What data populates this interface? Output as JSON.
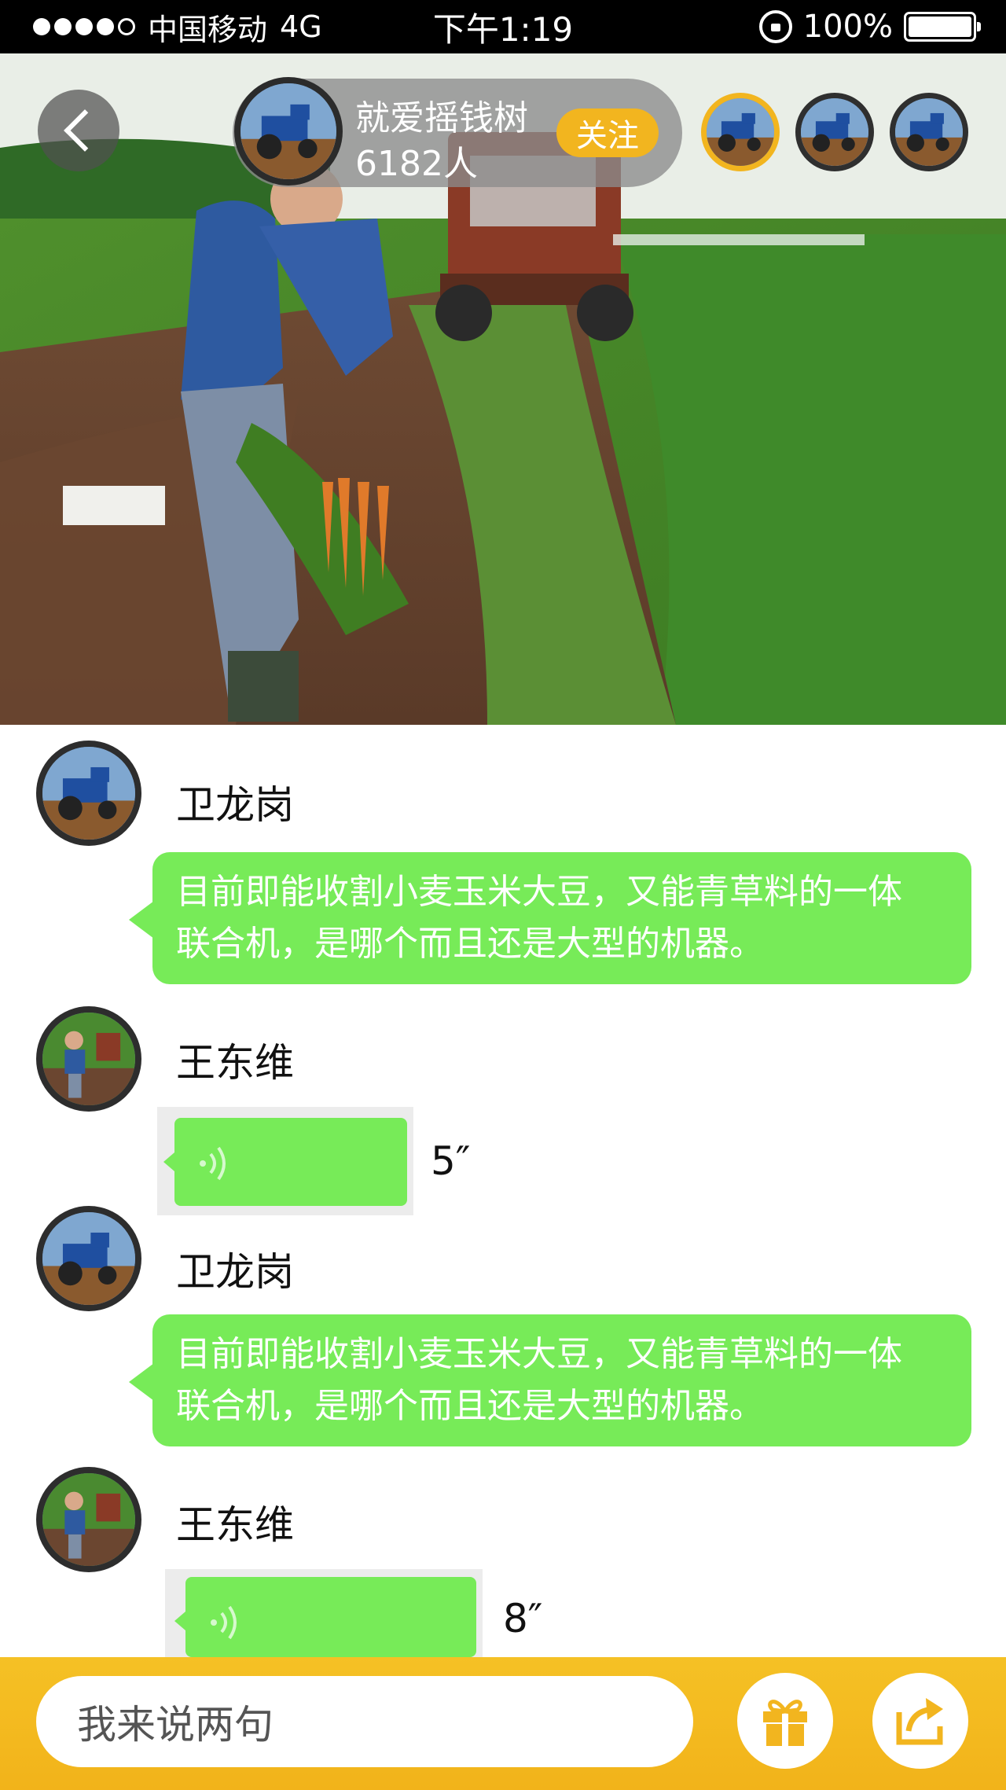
{
  "status_bar": {
    "carrier": "中国移动",
    "network": "4G",
    "time": "下午1:19",
    "battery": "100%"
  },
  "header": {
    "host_name": "就爱摇钱树",
    "viewer_count": "6182人",
    "follow_label": "关注"
  },
  "messages": [
    {
      "sender": "卫龙岗",
      "type": "text",
      "lines": [
        "目前即能收割小麦玉米大豆，又能青草料的一体",
        "联合机，是哪个而且还是大型的机器。"
      ]
    },
    {
      "sender": "王东维",
      "type": "voice",
      "duration": "5″"
    },
    {
      "sender": "卫龙岗",
      "type": "text",
      "lines": [
        "目前即能收割小麦玉米大豆，又能青草料的一体",
        "联合机，是哪个而且还是大型的机器。"
      ]
    },
    {
      "sender": "王东维",
      "type": "voice",
      "duration": "8″"
    }
  ],
  "bottom_bar": {
    "input_placeholder": "我来说两句"
  },
  "colors": {
    "bubble": "#77eb58",
    "accent": "#f2b51f",
    "status_bar": "#000000"
  },
  "icons": [
    "back-arrow-icon",
    "voice-wave-icon",
    "gift-icon",
    "share-icon"
  ]
}
